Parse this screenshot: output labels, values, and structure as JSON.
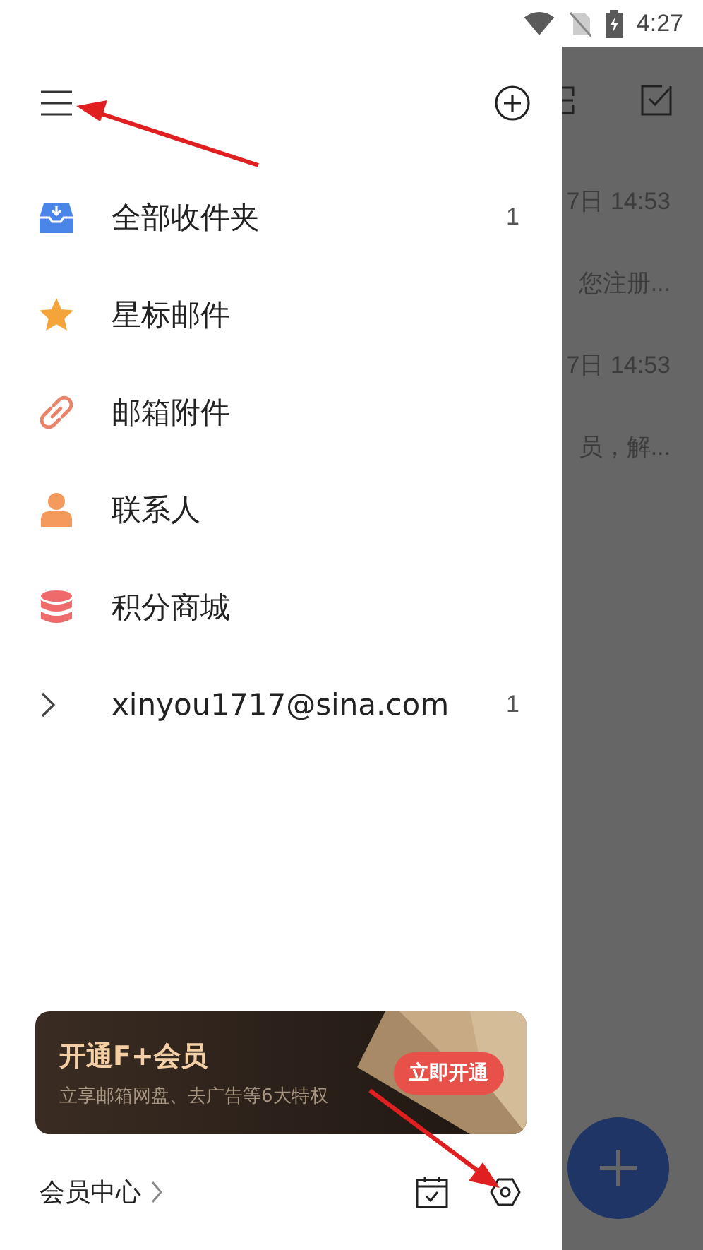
{
  "status_bar": {
    "time": "4:27"
  },
  "drawer": {
    "menu": [
      {
        "kind": "inbox",
        "label": "全部收件夹",
        "count": "1"
      },
      {
        "kind": "star",
        "label": "星标邮件"
      },
      {
        "kind": "attachment",
        "label": "邮箱附件"
      },
      {
        "kind": "contact",
        "label": "联系人"
      },
      {
        "kind": "points",
        "label": "积分商城"
      },
      {
        "kind": "account",
        "label": "xinyou1717@sina.com",
        "count": "1",
        "expanded": false
      }
    ],
    "promo": {
      "title": "开通F+会员",
      "subtitle": "立享邮箱网盘、去广告等6大特权",
      "button": "立即开通"
    },
    "footer": {
      "link": "会员中心"
    }
  },
  "background": {
    "rows": [
      {
        "time": "7日 14:53",
        "preview": "您注册..."
      },
      {
        "time": "7日 14:53",
        "preview": "员，解..."
      }
    ]
  }
}
